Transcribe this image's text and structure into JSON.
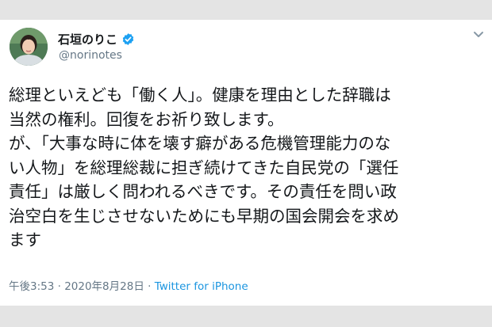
{
  "tweet": {
    "author": {
      "display_name": "石垣のりこ",
      "handle": "@norinotes",
      "verified": true
    },
    "body_lines": [
      "総理といえども「働く人」。健康を理由とした辞職は",
      "当然の権利。回復をお祈り致します。",
      "が、「大事な時に体を壊す癖がある危機管理能力のな",
      "い人物」を総理総裁に担ぎ続けてきた自民党の「選任",
      "責任」は厳しく問われるべきです。その責任を問い政",
      "治空白を生じさせないためにも早期の国会開会を求め",
      "ます"
    ],
    "meta": {
      "time": "午後3:53",
      "separator1": " · ",
      "date": "2020年8月28日",
      "separator2": " · ",
      "source": "Twitter for iPhone"
    }
  },
  "colors": {
    "text": "#14171a",
    "secondary": "#657786",
    "link": "#1b95e0",
    "verified": "#1da1f2",
    "background": "#e4e4e4"
  },
  "icons": {
    "verified": "verified-badge-icon",
    "caret": "chevron-down-icon"
  }
}
